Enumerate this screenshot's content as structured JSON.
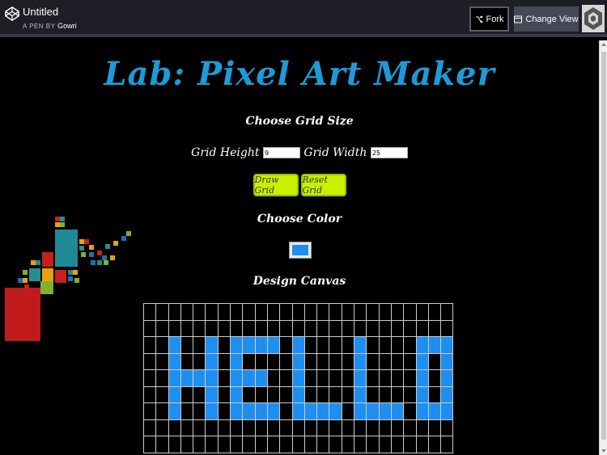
{
  "codepen": {
    "title": "Untitled",
    "by_prefix": "A PEN BY",
    "author": "Gowri",
    "fork_label": "Fork",
    "change_view_label": "Change View"
  },
  "page": {
    "title": "Lab: Pixel Art Maker",
    "grid_size_heading": "Choose Grid Size",
    "height_label": "Grid Height",
    "height_value": "9",
    "width_label": "Grid Width",
    "width_value": "25",
    "draw_button": "Draw Grid",
    "reset_button": "Reset Grid",
    "color_heading": "Choose Color",
    "selected_color": "#1e8ff0",
    "canvas_heading": "Design Canvas"
  },
  "canvas": {
    "rows": 9,
    "cols": 25,
    "fill_color": "#1e8ff0",
    "pattern": [
      ".........................",
      ".........................",
      "..X..X.XXXX.X....X....XXX",
      "..X..X.X....X....X....X.X",
      "..XXXX.XXX..X....X....X.X",
      "..X..X.X....X....X....X.X",
      "..X..X.XXXX.XXXX.XXXX.XXX",
      ".........................",
      "........................."
    ]
  }
}
